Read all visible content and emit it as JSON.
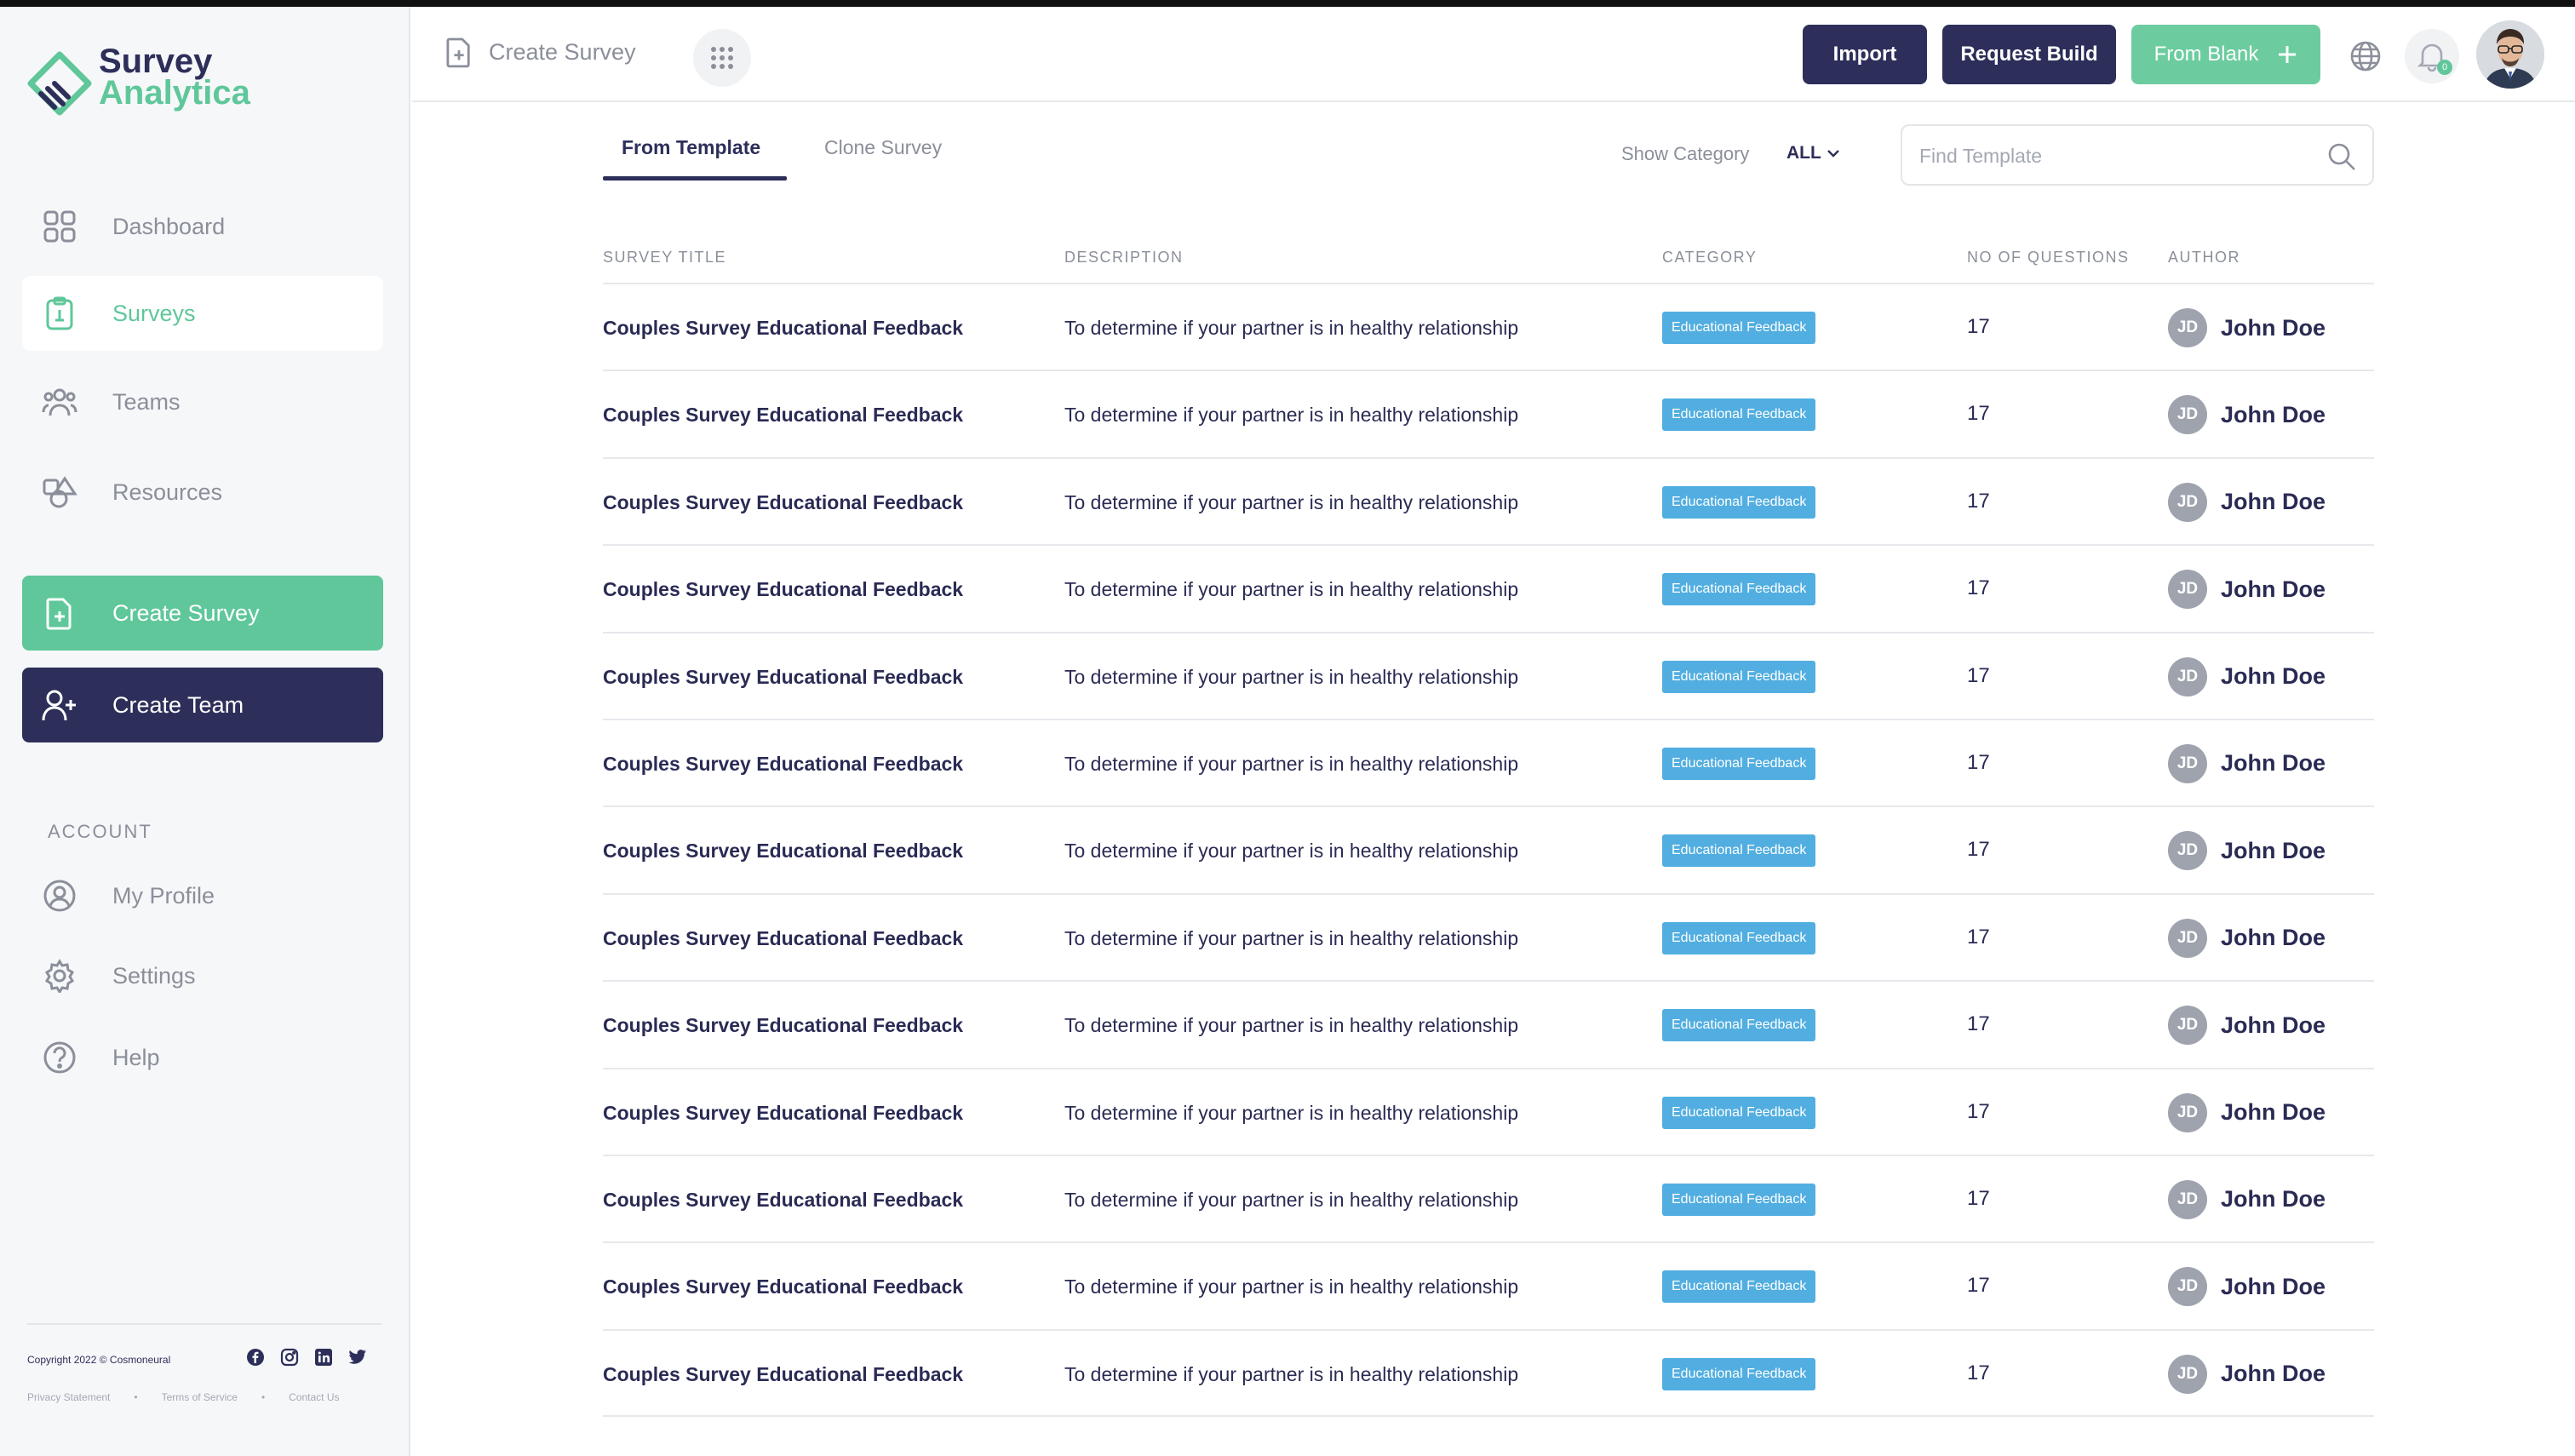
{
  "brand": {
    "line1": "Survey",
    "line2": "Analytica",
    "accent": "#5fc79a",
    "navy": "#2d2f5a"
  },
  "sidebar": {
    "nav": [
      {
        "label": "Dashboard",
        "icon": "grid-icon"
      },
      {
        "label": "Surveys",
        "icon": "clipboard-icon",
        "active": true
      },
      {
        "label": "Teams",
        "icon": "users-icon"
      },
      {
        "label": "Resources",
        "icon": "shapes-icon"
      }
    ],
    "create_survey": "Create Survey",
    "create_team": "Create Team",
    "account_heading": "ACCOUNT",
    "account": [
      {
        "label": "My Profile",
        "icon": "user-circle-icon"
      },
      {
        "label": "Settings",
        "icon": "gear-icon"
      },
      {
        "label": "Help",
        "icon": "help-icon"
      }
    ],
    "footer": {
      "copyright": "Copyright 2022 © Cosmoneural",
      "privacy": "Privacy Statement",
      "terms": "Terms of Service",
      "contact": "Contact Us"
    }
  },
  "topbar": {
    "crumb": "Create Survey",
    "import": "Import",
    "request_build": "Request Build",
    "from_blank": "From Blank",
    "notification_count": "0"
  },
  "content": {
    "tabs": {
      "from_template": "From Template",
      "clone_survey": "Clone Survey"
    },
    "show_category_label": "Show Category",
    "category_value": "ALL",
    "search_placeholder": "Find Template",
    "headers": {
      "title": "SURVEY TITLE",
      "description": "DESCRIPTION",
      "category": "CATEGORY",
      "questions": "NO OF QUESTIONS",
      "author": "AUTHOR"
    },
    "rows": [
      {
        "title": "Couples Survey Educational Feedback",
        "description": "To determine if your partner is in healthy relationship",
        "category": "Educational Feedback",
        "questions": "17",
        "initials": "JD",
        "author": "John Doe"
      },
      {
        "title": "Couples Survey Educational Feedback",
        "description": "To determine if your partner is in healthy relationship",
        "category": "Educational Feedback",
        "questions": "17",
        "initials": "JD",
        "author": "John Doe"
      },
      {
        "title": "Couples Survey Educational Feedback",
        "description": "To determine if your partner is in healthy relationship",
        "category": "Educational Feedback",
        "questions": "17",
        "initials": "JD",
        "author": "John Doe"
      },
      {
        "title": "Couples Survey Educational Feedback",
        "description": "To determine if your partner is in healthy relationship",
        "category": "Educational Feedback",
        "questions": "17",
        "initials": "JD",
        "author": "John Doe"
      },
      {
        "title": "Couples Survey Educational Feedback",
        "description": "To determine if your partner is in healthy relationship",
        "category": "Educational Feedback",
        "questions": "17",
        "initials": "JD",
        "author": "John Doe"
      },
      {
        "title": "Couples Survey Educational Feedback",
        "description": "To determine if your partner is in healthy relationship",
        "category": "Educational Feedback",
        "questions": "17",
        "initials": "JD",
        "author": "John Doe"
      },
      {
        "title": "Couples Survey Educational Feedback",
        "description": "To determine if your partner is in healthy relationship",
        "category": "Educational Feedback",
        "questions": "17",
        "initials": "JD",
        "author": "John Doe"
      },
      {
        "title": "Couples Survey Educational Feedback",
        "description": "To determine if your partner is in healthy relationship",
        "category": "Educational Feedback",
        "questions": "17",
        "initials": "JD",
        "author": "John Doe"
      },
      {
        "title": "Couples Survey Educational Feedback",
        "description": "To determine if your partner is in healthy relationship",
        "category": "Educational Feedback",
        "questions": "17",
        "initials": "JD",
        "author": "John Doe"
      },
      {
        "title": "Couples Survey Educational Feedback",
        "description": "To determine if your partner is in healthy relationship",
        "category": "Educational Feedback",
        "questions": "17",
        "initials": "JD",
        "author": "John Doe"
      },
      {
        "title": "Couples Survey Educational Feedback",
        "description": "To determine if your partner is in healthy relationship",
        "category": "Educational Feedback",
        "questions": "17",
        "initials": "JD",
        "author": "John Doe"
      },
      {
        "title": "Couples Survey Educational Feedback",
        "description": "To determine if your partner is in healthy relationship",
        "category": "Educational Feedback",
        "questions": "17",
        "initials": "JD",
        "author": "John Doe"
      },
      {
        "title": "Couples Survey Educational Feedback",
        "description": "To determine if your partner is in healthy relationship",
        "category": "Educational Feedback",
        "questions": "17",
        "initials": "JD",
        "author": "John Doe"
      }
    ]
  }
}
